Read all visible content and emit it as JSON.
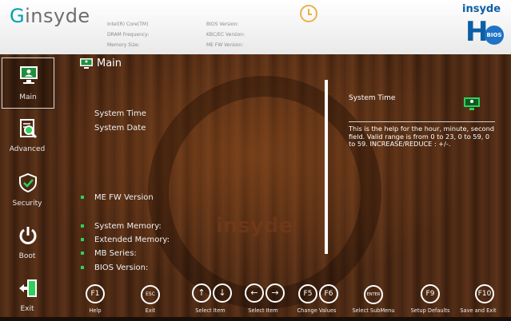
{
  "header": {
    "brand": "insyde",
    "brand_prefix": "G",
    "info_left": [
      "Intel(R) Core(TM)",
      "DRAM Frequency:",
      "Memory Size:"
    ],
    "info_right": [
      "BIOS Version:",
      "KBC/EC Version:",
      "ME FW Version:"
    ],
    "h2o_title": "insyde",
    "h2o_H": "H",
    "h2o_bios": "BIOS"
  },
  "sidebar": {
    "items": [
      {
        "label": "Main",
        "icon": "monitor-icon",
        "active": true
      },
      {
        "label": "Advanced",
        "icon": "search-document-icon",
        "active": false
      },
      {
        "label": "Security",
        "icon": "shield-icon",
        "active": false
      },
      {
        "label": "Boot",
        "icon": "power-icon",
        "active": false
      },
      {
        "label": "Exit",
        "icon": "exit-door-icon",
        "active": false
      }
    ]
  },
  "main": {
    "title": "Main",
    "items": [
      {
        "label": "System Time",
        "bullet": false
      },
      {
        "label": "System Date",
        "bullet": false
      },
      {
        "label": "ME FW Version",
        "bullet": true
      },
      {
        "label": "System Memory:",
        "bullet": true
      },
      {
        "label": "Extended Memory:",
        "bullet": true
      },
      {
        "label": "MB Series:",
        "bullet": true
      },
      {
        "label": "BIOS Version:",
        "bullet": true
      }
    ]
  },
  "help": {
    "title": "System Time",
    "text": "This is the help for the hour, minute, second field. Valid range is from 0 to 23, 0 to 59, 0 to 59. INCREASE/REDUCE : +/-."
  },
  "footer": {
    "keys": [
      {
        "keys": [
          "F1"
        ],
        "label": "Help"
      },
      {
        "keys": [
          "ESC"
        ],
        "label": "Exit"
      },
      {
        "keys": [
          "↑",
          "↓"
        ],
        "label": "Select Item"
      },
      {
        "keys": [
          "←",
          "→"
        ],
        "label": "Select Item"
      },
      {
        "keys": [
          "F5",
          "F6"
        ],
        "label": "Change Values"
      },
      {
        "keys": [
          "ENTER"
        ],
        "label": "Select SubMenu"
      },
      {
        "keys": [
          "F9"
        ],
        "label": "Setup Defaults"
      },
      {
        "keys": [
          "F10"
        ],
        "label": "Save and Exit"
      }
    ]
  },
  "watermark": "insyde",
  "colors": {
    "accent_green": "#2ed05b",
    "brand_teal": "#00a0b0",
    "brand_blue": "#0b5fa6",
    "clock": "#e9b24a"
  }
}
